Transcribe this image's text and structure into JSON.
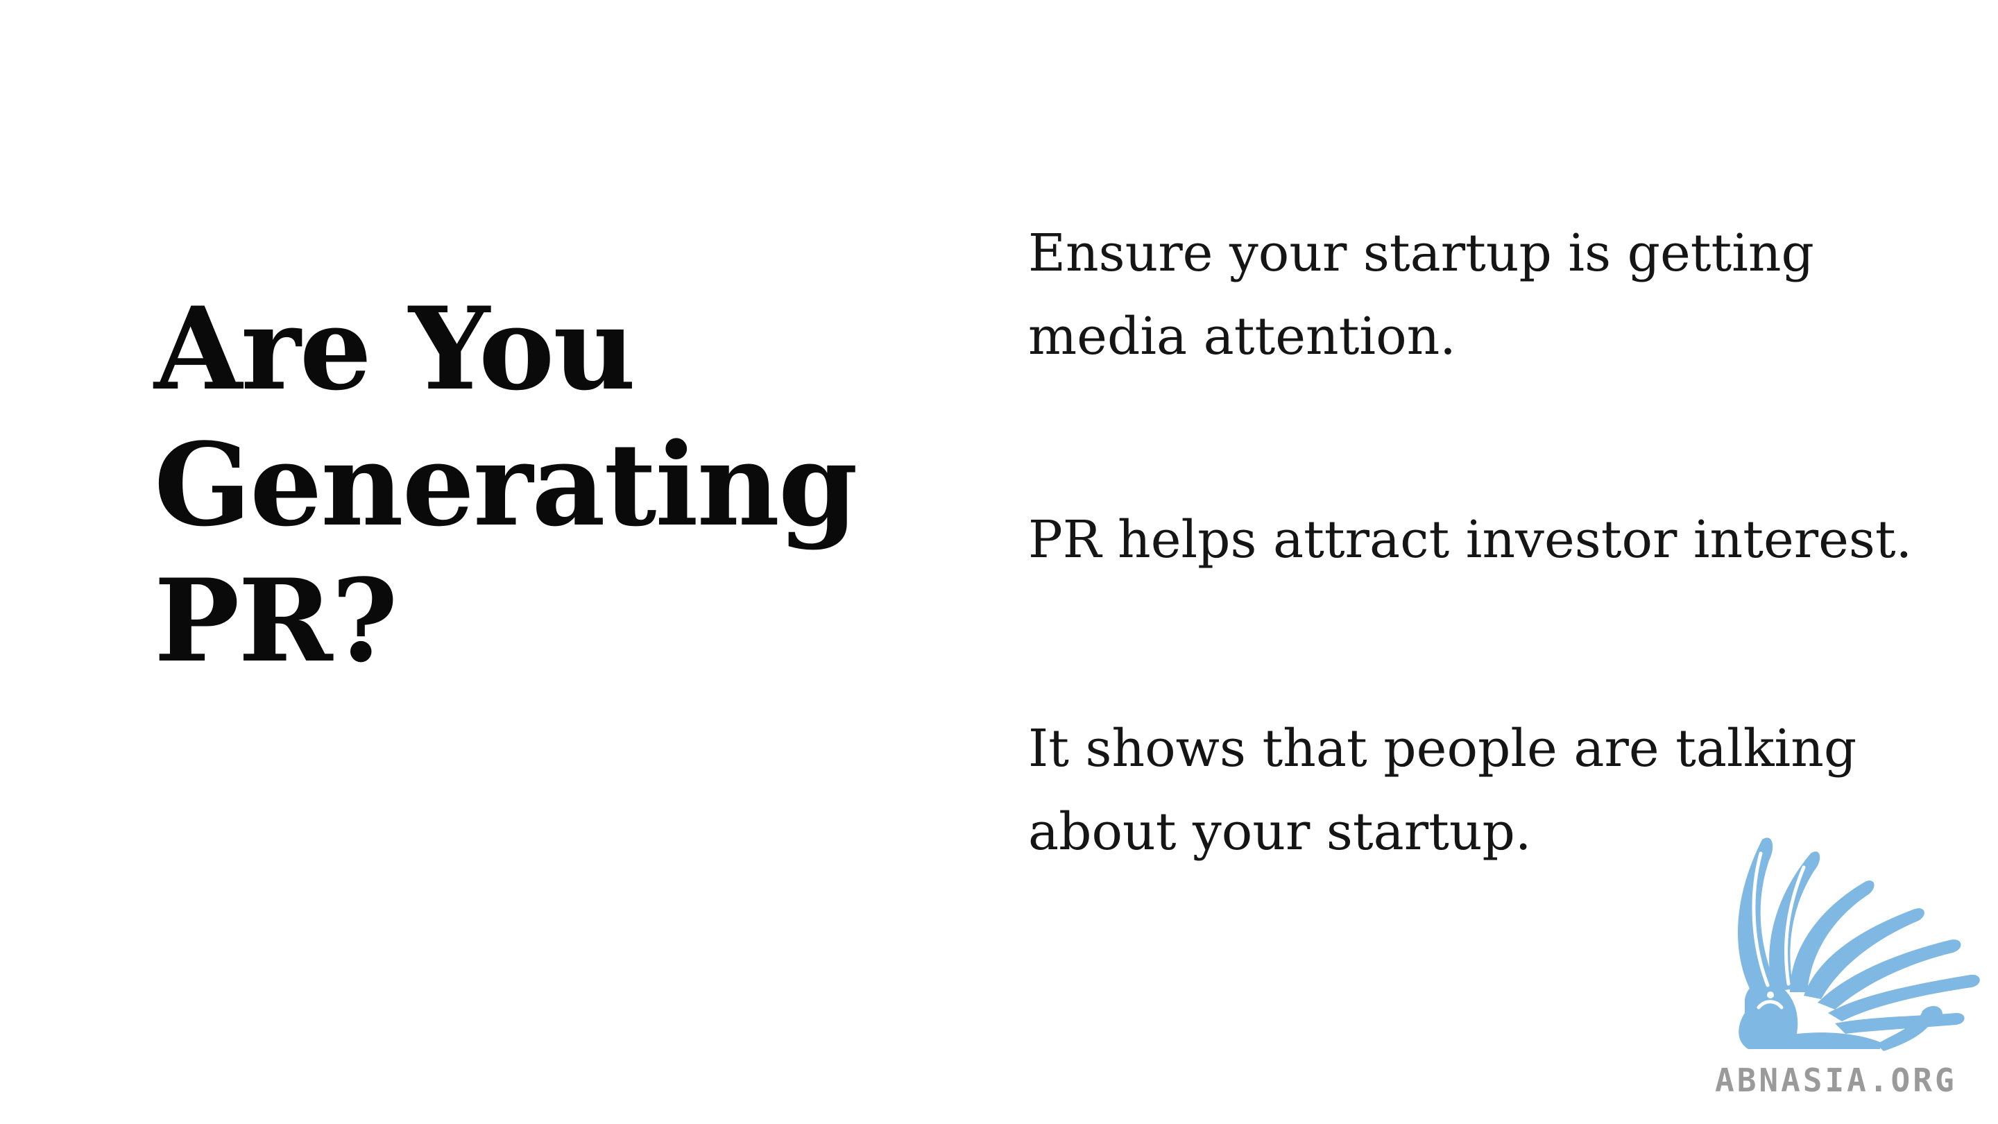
{
  "slide": {
    "title_lines": [
      "Are You",
      "Generating",
      "PR?"
    ],
    "points": [
      {
        "lines": [
          "Ensure your startup is getting",
          "media attention."
        ]
      },
      {
        "lines": [
          "PR helps attract investor interest."
        ]
      },
      {
        "lines": [
          "It shows that people are talking",
          "about your startup."
        ]
      }
    ]
  },
  "logo": {
    "text": "ABNASIA.ORG",
    "icon": "griffin-icon",
    "color": "#7fb8e2"
  }
}
